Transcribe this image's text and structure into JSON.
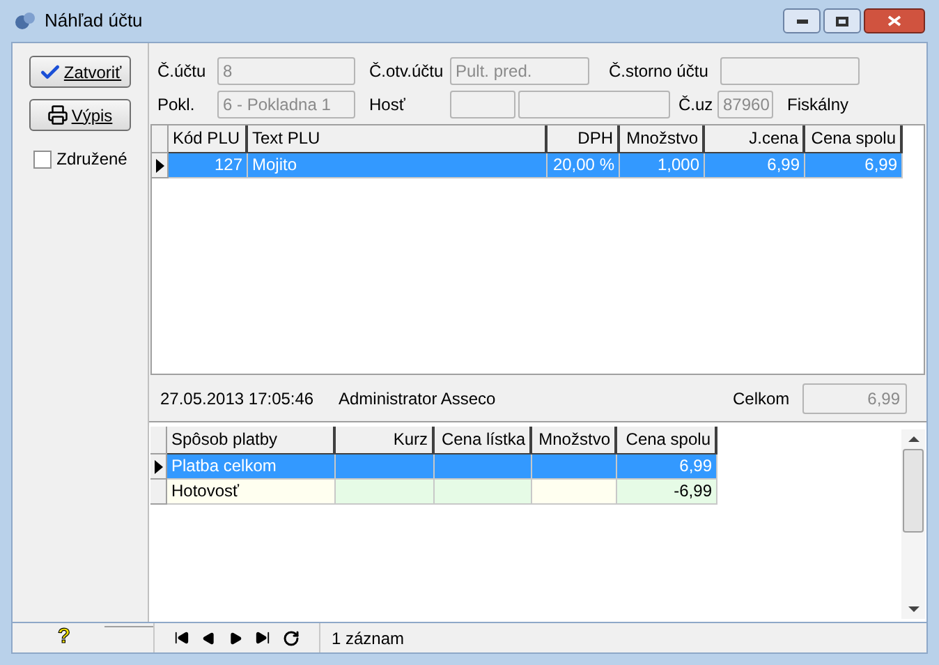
{
  "window": {
    "title": "Náhľad účtu"
  },
  "buttons": [
    {
      "kind": "close",
      "label": "Zatvoriť"
    },
    {
      "kind": "print",
      "label": "Výpis"
    }
  ],
  "grouped": {
    "label": "Združené",
    "checked": false
  },
  "header": {
    "account_label": "Č.účtu",
    "account": "8",
    "open_label": "Č.otv.účtu",
    "open": "Pult. pred.",
    "storno_label": "Č.storno účtu",
    "register_label": "Pokl.",
    "register": "6 - Pokladna 1",
    "guest_label": "Hosť",
    "user_label": "Č.uz",
    "user": "87960",
    "fiscal": "Fiskálny"
  },
  "items": {
    "columns": [
      "Kód PLU",
      "Text PLU",
      "DPH",
      "Množstvo",
      "J.cena",
      "Cena spolu"
    ],
    "rows": [
      {
        "cells": [
          "127",
          "Mojito",
          "20,00 %",
          "1,000",
          "6,99",
          "6,99"
        ],
        "selected": true
      }
    ]
  },
  "info": {
    "datetime": "27.05.2013 17:05:46",
    "user": "Administrator Asseco",
    "total_label": "Celkom",
    "total": "6,99"
  },
  "payments": {
    "columns": [
      "Spôsob platby",
      "Kurz",
      "Cena lístka",
      "Množstvo",
      "Cena spolu"
    ],
    "rows": [
      {
        "cells": [
          "Platba celkom",
          "",
          "",
          "",
          "6,99"
        ],
        "selected": true
      },
      {
        "cells": [
          "Hotovosť",
          "",
          "",
          "",
          "-6,99"
        ],
        "selected": false
      }
    ]
  },
  "status_bar": {
    "help": "?",
    "records": "1 záznam"
  }
}
